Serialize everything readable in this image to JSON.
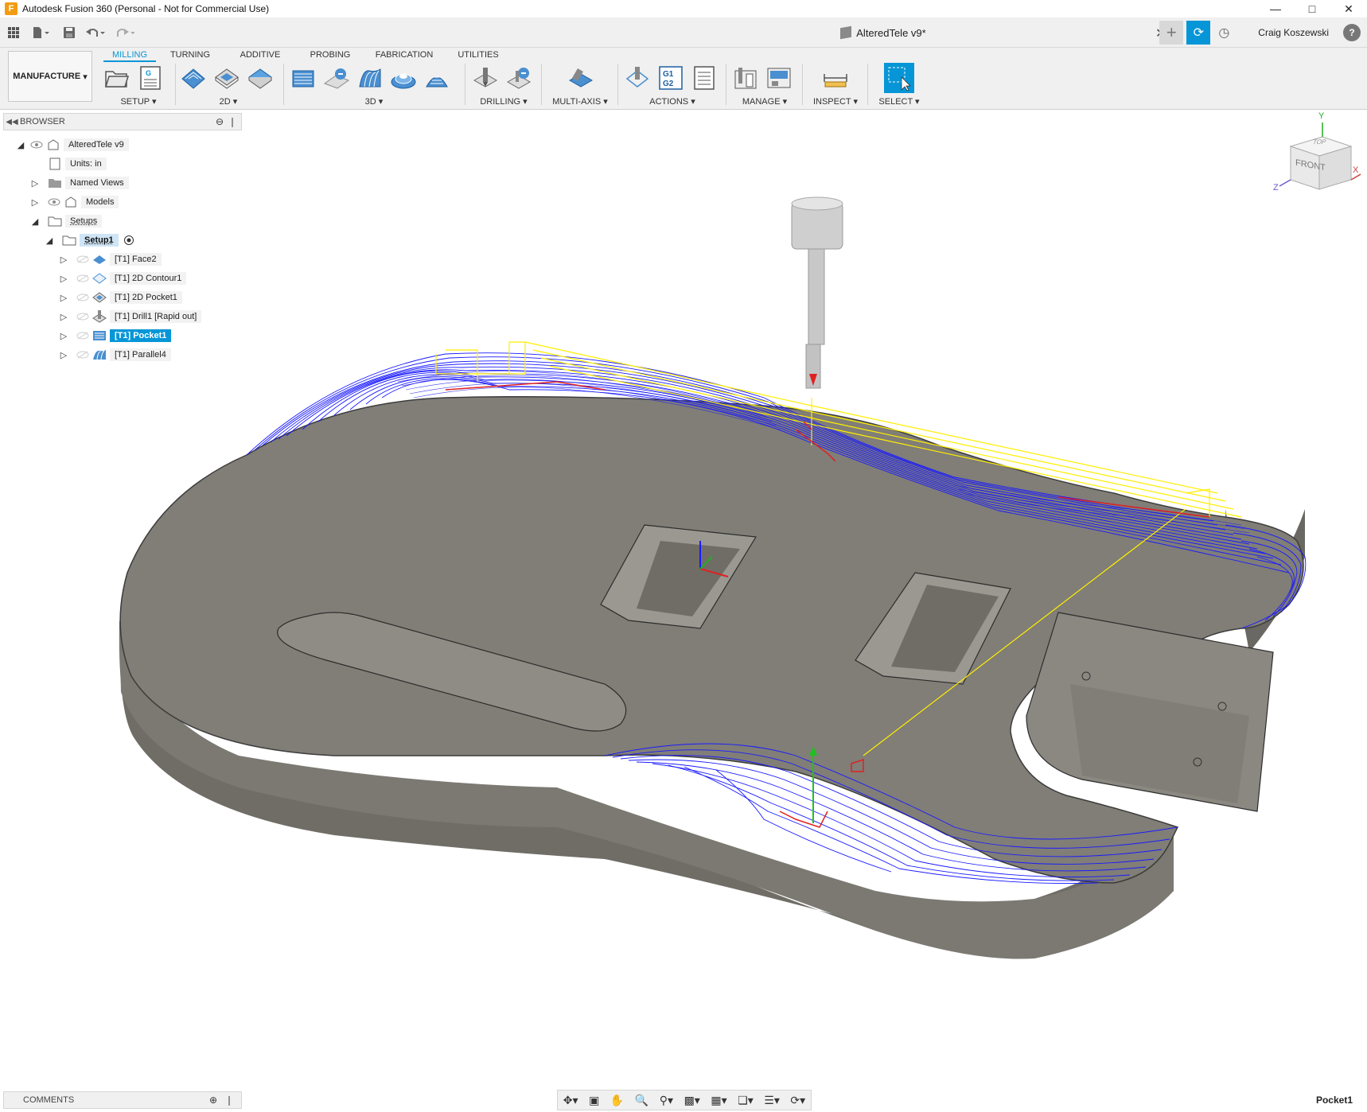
{
  "window": {
    "title": "Autodesk Fusion 360 (Personal - Not for Commercial Use)",
    "app_icon": "F"
  },
  "toolbar": {
    "document_name": "AlteredTele v9*",
    "user_name": "Craig Koszewski",
    "help": "?"
  },
  "ribbon": {
    "workspace": "MANUFACTURE",
    "tabs": [
      "MILLING",
      "TURNING",
      "ADDITIVE",
      "PROBING",
      "FABRICATION",
      "UTILITIES"
    ],
    "active_tab": "MILLING",
    "groups": {
      "setup": "SETUP",
      "twod": "2D",
      "threed": "3D",
      "drilling": "DRILLING",
      "multiaxis": "MULTI-AXIS",
      "actions": "ACTIONS",
      "manage": "MANAGE",
      "inspect": "INSPECT",
      "select": "SELECT"
    },
    "gcode_icon_text": "G1\nG2"
  },
  "browser": {
    "title": "BROWSER",
    "root": "AlteredTele v9",
    "units": "Units: in",
    "named_views": "Named Views",
    "models": "Models",
    "setups": "Setups",
    "setup1": "Setup1",
    "operations": [
      {
        "label": "[T1] Face2",
        "selected": false
      },
      {
        "label": "[T1] 2D Contour1",
        "selected": false
      },
      {
        "label": "[T1] 2D Pocket1",
        "selected": false
      },
      {
        "label": "[T1] Drill1 [Rapid out]",
        "selected": false
      },
      {
        "label": "[T1] Pocket1",
        "selected": true
      },
      {
        "label": "[T1] Parallel4",
        "selected": false
      }
    ]
  },
  "viewcube": {
    "top": "TOP",
    "front": "FRONT",
    "axis_x": "X",
    "axis_y": "Y",
    "axis_z": "Z"
  },
  "comments": {
    "title": "COMMENTS"
  },
  "status": {
    "selected_operation": "Pocket1"
  },
  "colors": {
    "accent": "#0696d7",
    "body": "#8a8880",
    "toolpath": "#1a1aff",
    "rapid": "#ffee00",
    "plunge": "#e02020"
  }
}
